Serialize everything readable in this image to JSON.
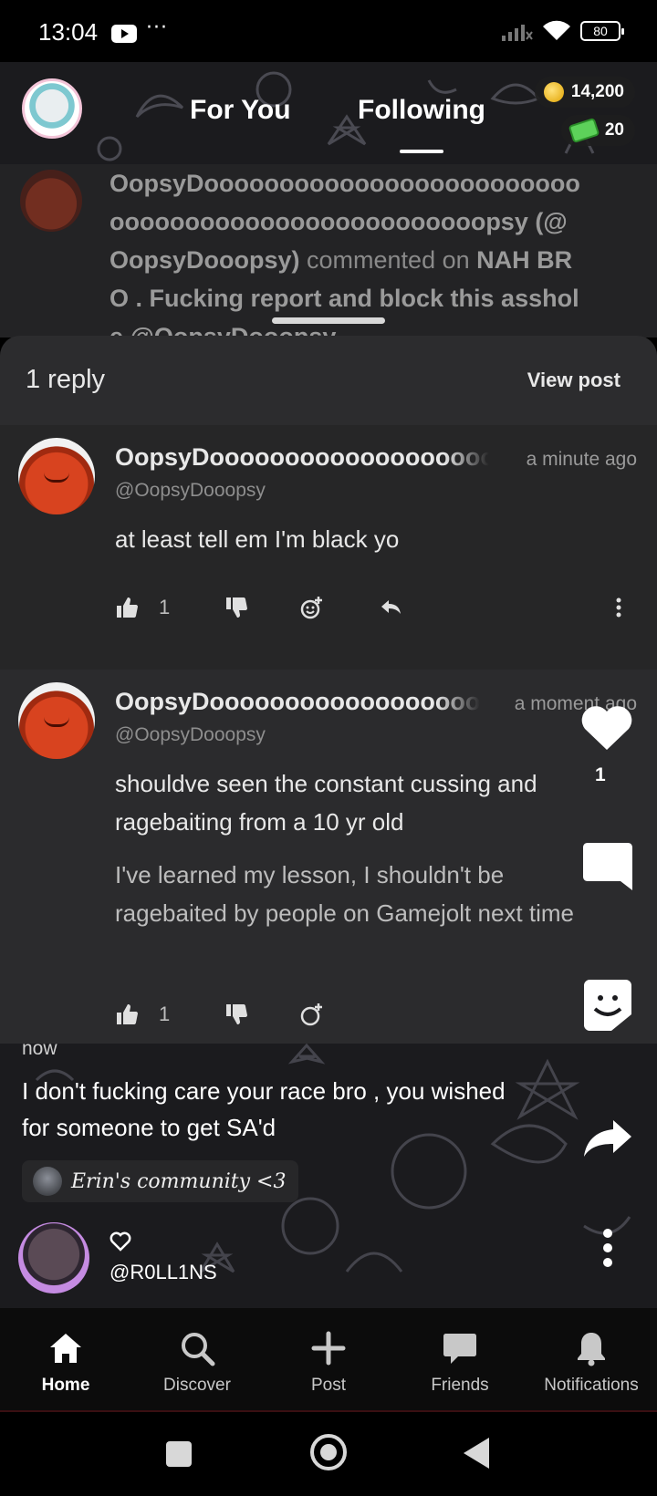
{
  "status_bar": {
    "time": "13:04",
    "overflow": "···",
    "battery": "80"
  },
  "top_nav": {
    "tabs": [
      {
        "label": "For You",
        "active": false
      },
      {
        "label": "Following",
        "active": true
      }
    ],
    "coins": "14,200",
    "cash": "20"
  },
  "background_notification": {
    "text_prefix": "OopsyDoooooooooooooooooooooooooooooooooooooooooooooooooopsy (@OopsyDooopsy)",
    "text_mid": " commented on ",
    "text_post": "NAH BRO . Fucking report and block this asshole @OopsyDooopsy"
  },
  "sheet": {
    "reply_count": "1 reply",
    "view_post": "View post",
    "comments": [
      {
        "name": "OopsyDoooooooooooooooooooo",
        "handle": "@OopsyDooopsy",
        "time": "a minute ago",
        "body": [
          "at least tell em I'm black yo"
        ],
        "likes": "1"
      },
      {
        "name": "OopsyDoooooooooooooooooooo",
        "handle": "@OopsyDooopsy",
        "time": "a moment ago",
        "body": [
          "shouldve seen the constant cussing and ragebaiting from a 10 yr old",
          "I've learned my lesson, I shouldn't be ragebaited by people on Gamejolt next time"
        ],
        "likes": "1"
      }
    ]
  },
  "post": {
    "time": "now",
    "text": "I don't fucking care your race bro , you wished for someone to get SA'd",
    "community": "Erin's community <3",
    "poster_handle": "@R0LL1NS",
    "like_count": "1"
  },
  "bottom_nav": {
    "items": [
      {
        "label": "Home",
        "icon": "home-icon",
        "active": true
      },
      {
        "label": "Discover",
        "icon": "search-icon",
        "active": false
      },
      {
        "label": "Post",
        "icon": "plus-icon",
        "active": false
      },
      {
        "label": "Friends",
        "icon": "chat-icon",
        "active": false
      },
      {
        "label": "Notifications",
        "icon": "bell-icon",
        "active": false
      }
    ]
  },
  "colors": {
    "background": "#1b1b1e",
    "sheet": "#262627",
    "accent": "#ffffff"
  }
}
